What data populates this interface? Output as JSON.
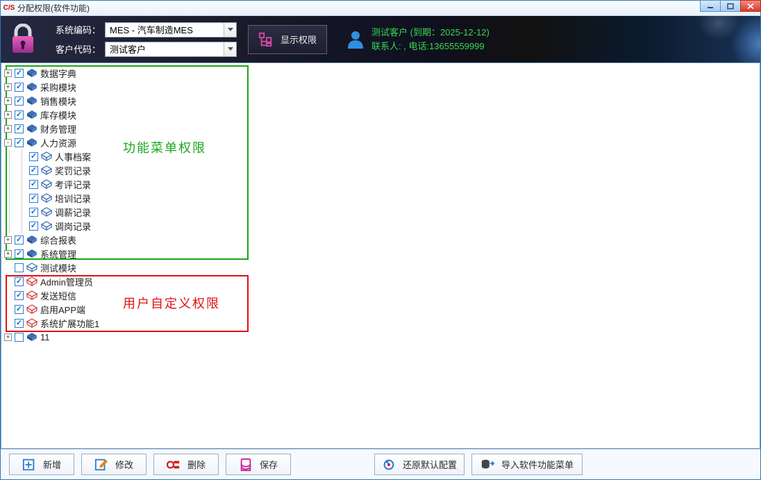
{
  "window": {
    "title": "分配权限(软件功能)"
  },
  "header": {
    "label_system_code": "系统编码：",
    "system_code_value": "MES - 汽车制造MES",
    "label_customer_code": "客户代码：",
    "customer_code_value": "测试客户",
    "show_perm_button": "显示权限",
    "info_line1": "测试客户 (到期：2025-12-12)",
    "info_line2": "联系人: , 电话:13655559999"
  },
  "annotations": {
    "green_label": "功能菜单权限",
    "red_label": "用户自定义权限"
  },
  "tree": {
    "data_dict": {
      "label": "数据字典",
      "checked": true,
      "expander": "+",
      "icon": "solid"
    },
    "procurement": {
      "label": "采购模块",
      "checked": true,
      "expander": "+",
      "icon": "solid"
    },
    "sales": {
      "label": "销售模块",
      "checked": true,
      "expander": "+",
      "icon": "solid"
    },
    "inventory": {
      "label": "库存模块",
      "checked": true,
      "expander": "+",
      "icon": "solid"
    },
    "finance": {
      "label": "财务管理",
      "checked": true,
      "expander": "+",
      "icon": "solid"
    },
    "hr": {
      "label": "人力资源",
      "checked": true,
      "expander": "-",
      "icon": "solid",
      "children": {
        "personnel": {
          "label": "人事档案",
          "checked": true,
          "icon": "outline"
        },
        "reward": {
          "label": "奖罚记录",
          "checked": true,
          "icon": "outline"
        },
        "review": {
          "label": "考评记录",
          "checked": true,
          "icon": "outline"
        },
        "training": {
          "label": "培训记录",
          "checked": true,
          "icon": "outline"
        },
        "salary": {
          "label": "调薪记录",
          "checked": true,
          "icon": "outline"
        },
        "transfer": {
          "label": "调岗记录",
          "checked": true,
          "icon": "outline"
        }
      }
    },
    "reports": {
      "label": "综合报表",
      "checked": true,
      "expander": "+",
      "icon": "solid"
    },
    "system": {
      "label": "系统管理",
      "checked": true,
      "expander": "+",
      "icon": "solid"
    },
    "test_module": {
      "label": "测试模块",
      "checked": false,
      "expander": "",
      "icon": "outline"
    },
    "admin": {
      "label": "Admin管理员",
      "checked": true,
      "expander": "",
      "icon": "outline-red"
    },
    "sms": {
      "label": "发送短信",
      "checked": true,
      "expander": "",
      "icon": "outline-red"
    },
    "app": {
      "label": "启用APP端",
      "checked": true,
      "expander": "",
      "icon": "outline-red"
    },
    "ext1": {
      "label": "系统扩展功能1",
      "checked": true,
      "expander": "",
      "icon": "outline-red"
    },
    "eleven": {
      "label": "11",
      "checked": false,
      "expander": "+",
      "icon": "solid"
    }
  },
  "toolbar": {
    "new": "新增",
    "edit": "修改",
    "delete": "删除",
    "save": "保存",
    "restore": "还原默认配置",
    "import": "导入软件功能菜单"
  },
  "colors": {
    "accent_blue": "#2a7bd4",
    "anno_green": "#1aa61a",
    "anno_red": "#e01010",
    "info_green": "#37d84f",
    "magenta": "#c91f8d"
  }
}
